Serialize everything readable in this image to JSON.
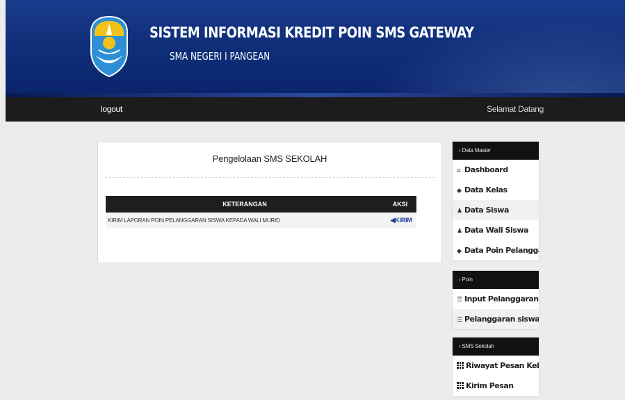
{
  "header": {
    "title": "SISTEM INFORMASI KREDIT POIN SMS GATEWAY",
    "subtitle": "SMA NEGERI I PANGEAN"
  },
  "nav": {
    "logout": "logout",
    "welcome": "Selamat Datang"
  },
  "main": {
    "title": "Pengelolaan SMS SEKOLAH",
    "columns": [
      "KETERANGAN",
      "AKSI"
    ],
    "rows": [
      {
        "keterangan": "KIRIM LAPORAN POIN PELANGGARAN SISWA KEPADA WALI MURID",
        "aksi": "KIRIM"
      }
    ]
  },
  "sidebar": {
    "sections": [
      {
        "heading": "› Data Master",
        "items": [
          {
            "label": "Dashboard",
            "icon": "home-icon"
          },
          {
            "label": "Data Kelas",
            "icon": "tag-icon"
          },
          {
            "label": "Data Siswa",
            "icon": "user-icon"
          },
          {
            "label": "Data Wali Siswa",
            "icon": "user-icon"
          },
          {
            "label": "Data Poin Pelanggaran",
            "icon": "tag-icon"
          }
        ]
      },
      {
        "heading": "› Poin",
        "items": [
          {
            "label": "Input Pelanggaran",
            "icon": "list-icon"
          },
          {
            "label": "Pelanggaran siswa",
            "icon": "list-icon"
          }
        ]
      },
      {
        "heading": "› SMS Sekolah",
        "items": [
          {
            "label": "Riwayat Pesan Keluar",
            "icon": "calculator-icon"
          },
          {
            "label": "Kirim Pesan",
            "icon": "calculator-icon"
          }
        ]
      }
    ]
  },
  "colors": {
    "banner": "#0f2f7a",
    "navbar": "#1c1c1c",
    "link": "#1e3d96"
  }
}
